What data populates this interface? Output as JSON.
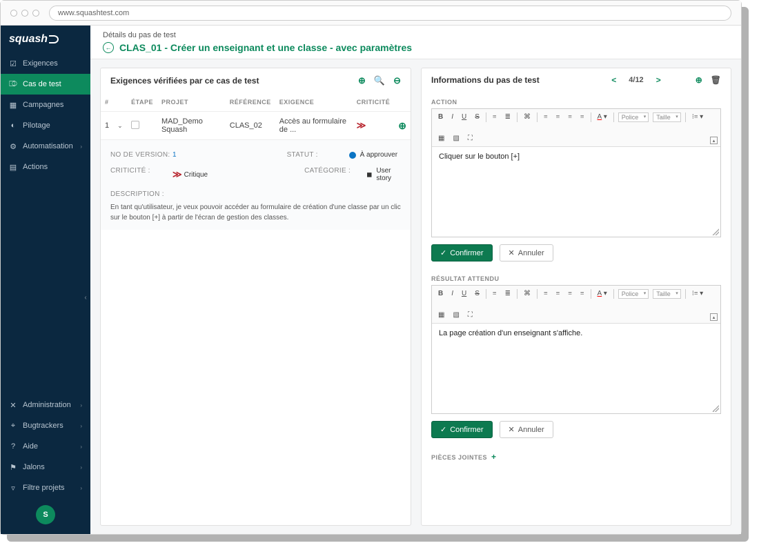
{
  "url": "www.squashtest.com",
  "logo": "squash",
  "sidebar": {
    "items": [
      {
        "icon": "☑",
        "label": "Exigences"
      },
      {
        "icon": "⎄",
        "label": "Cas de test"
      },
      {
        "icon": "🗓",
        "label": "Campagnes"
      },
      {
        "icon": "◐",
        "label": "Pilotage"
      },
      {
        "icon": "⚙",
        "label": "Automatisation",
        "sub": true
      },
      {
        "icon": "≡",
        "label": "Actions"
      }
    ],
    "bottom": [
      {
        "icon": "✕",
        "label": "Administration",
        "sub": true
      },
      {
        "icon": "⌖",
        "label": "Bugtrackers",
        "sub": true
      },
      {
        "icon": "?",
        "label": "Aide",
        "sub": true
      },
      {
        "icon": "⚑",
        "label": "Jalons",
        "sub": true
      },
      {
        "icon": "▿",
        "label": "Filtre projets",
        "sub": true
      }
    ],
    "avatar": "S"
  },
  "header": {
    "crumb": "Détails du pas de test",
    "title": "CLAS_01 - Créer un enseignant et une classe - avec paramètres"
  },
  "left": {
    "title": "Exigences vérifiées par ce cas de test",
    "cols": {
      "num": "#",
      "step": "ÉTAPE",
      "project": "PROJET",
      "ref": "RÉFÉRENCE",
      "req": "EXIGENCE",
      "crit": "CRITICITÉ"
    },
    "row": {
      "num": "1",
      "project": "MAD_Demo Squash",
      "ref": "CLAS_02",
      "req": "Accès au formulaire de ..."
    },
    "details": {
      "version_lab": "NO DE VERSION:",
      "version": "1",
      "status_lab": "STATUT :",
      "status": "À approuver",
      "crit_lab": "CRITICITÉ :",
      "crit": "Critique",
      "cat_lab": "CATÉGORIE :",
      "cat": "User story",
      "desc_lab": "DESCRIPTION :",
      "desc": "En tant qu'utilisateur, je veux pouvoir accéder au formulaire de création d'une classe par un clic sur le bouton [+] à partir de l'écran de gestion des classes."
    }
  },
  "right": {
    "title": "Informations du pas de test",
    "page": "4/12",
    "action_lab": "ACTION",
    "action_text": "Cliquer sur le bouton [+]",
    "result_lab": "RÉSULTAT ATTENDU",
    "result_text": "La page création d'un enseignant s'affiche.",
    "attach_lab": "PIÈCES JOINTES",
    "font": "Police",
    "size": "Taille",
    "confirm": "Confirmer",
    "cancel": "Annuler"
  }
}
